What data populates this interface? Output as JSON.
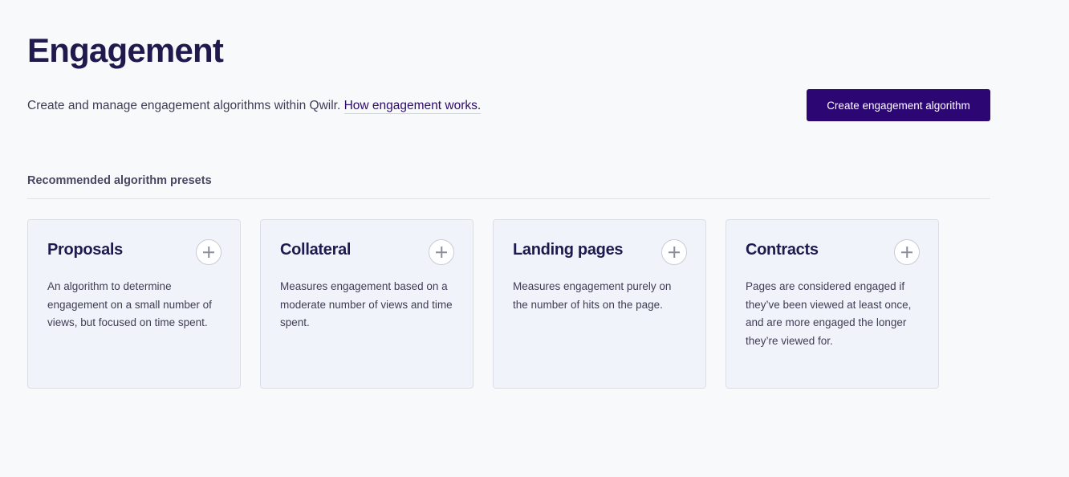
{
  "header": {
    "title": "Engagement",
    "intro_text": "Create and manage engagement algorithms within Qwilr. ",
    "intro_link": "How engagement works.",
    "create_button": "Create engagement algorithm"
  },
  "presets": {
    "section_label": "Recommended algorithm presets",
    "cards": [
      {
        "title": "Proposals",
        "description": "An algorithm to determine engagement on a small number of views, but focused on time spent."
      },
      {
        "title": "Collateral",
        "description": "Measures engagement based on a moderate number of views and time spent."
      },
      {
        "title": "Landing pages",
        "description": "Measures engagement purely on the number of hits on the page."
      },
      {
        "title": "Contracts",
        "description": "Pages are considered engaged if they’ve been viewed at least once, and are more engaged the longer they’re viewed for."
      }
    ]
  },
  "icons": {
    "add": "plus-icon"
  },
  "colors": {
    "primary": "#2c0673",
    "title": "#1e1a4d",
    "background": "#f8f9fb",
    "card_background": "#f0f3f9"
  }
}
